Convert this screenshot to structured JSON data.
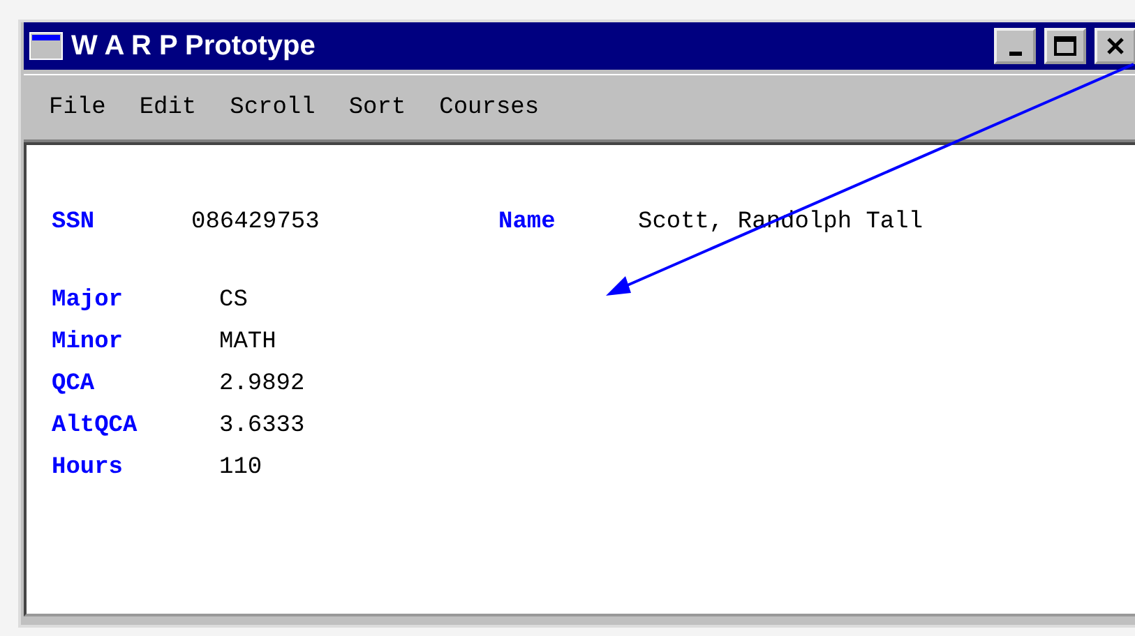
{
  "window": {
    "title": "W A R P Prototype"
  },
  "menu": [
    "File",
    "Edit",
    "Scroll",
    "Sort",
    "Courses"
  ],
  "header": [
    {
      "label": "SSN",
      "value": "086429753"
    },
    {
      "label": "Name",
      "value": "Scott, Randolph Tall"
    }
  ],
  "fields": [
    {
      "label": "Major",
      "value": "CS"
    },
    {
      "label": "Minor",
      "value": "MATH"
    },
    {
      "label": "QCA",
      "value": "2.9892"
    },
    {
      "label": "AltQCA",
      "value": "3.6333"
    },
    {
      "label": "Hours",
      "value": "110"
    }
  ]
}
